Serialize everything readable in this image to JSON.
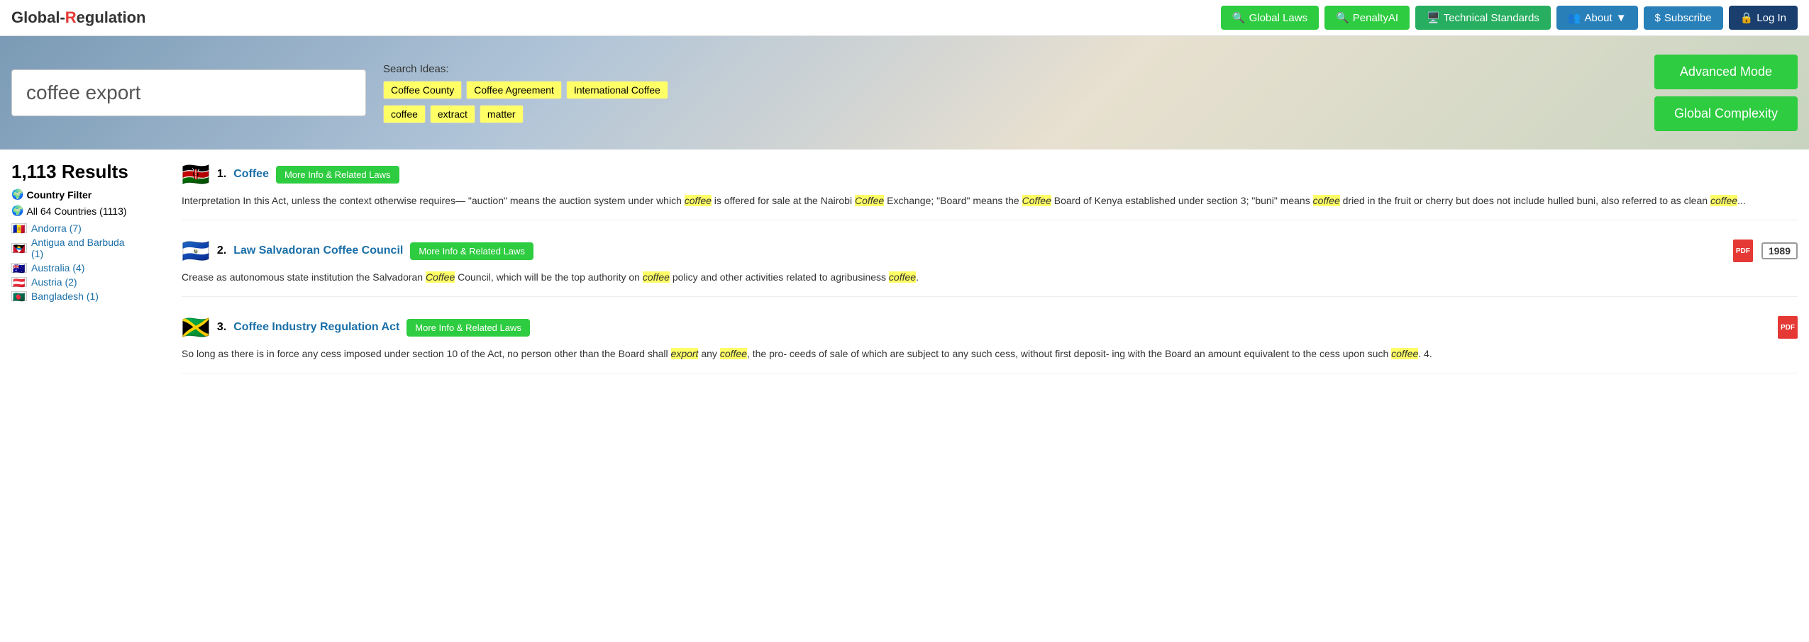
{
  "logo": {
    "text_g": "Global-",
    "text_r": "R",
    "text_rest": "egulation"
  },
  "nav": {
    "global_laws": "Global Laws",
    "penalty_ai": "PenaltyAI",
    "technical_standards": "Technical Standards",
    "about": "About",
    "subscribe": "Subscribe",
    "log_in": "Log In"
  },
  "search": {
    "value": "coffee export",
    "ideas_label": "Search Ideas:",
    "ideas_row1": [
      "Coffee County",
      "Coffee Agreement",
      "International Coffee"
    ],
    "ideas_row2": [
      "coffee",
      "extract",
      "matter"
    ]
  },
  "hero_buttons": {
    "advanced_mode": "Advanced Mode",
    "global_complexity": "Global Complexity"
  },
  "sidebar": {
    "results_count": "1,113 Results",
    "country_filter_label": "Country Filter",
    "all_countries": "All 64 Countries (1113)",
    "countries": [
      {
        "flag": "🇦🇩",
        "name": "Andorra",
        "count": "(7)"
      },
      {
        "flag": "🇦🇬",
        "name": "Antigua and Barbuda",
        "count": "(1)"
      },
      {
        "flag": "🇦🇺",
        "name": "Australia",
        "count": "(4)"
      },
      {
        "flag": "🇦🇹",
        "name": "Austria",
        "count": "(2)"
      },
      {
        "flag": "🇧🇩",
        "name": "Bangladesh",
        "count": "(1)"
      }
    ]
  },
  "results": [
    {
      "num": "1.",
      "title": "Coffee",
      "more_info_btn": "More Info & Related Laws",
      "flag": "kenya",
      "flag_emoji": "🇰🇪",
      "snippet": "Interpretation In this Act, unless the context otherwise requires— \"auction\" means the auction system under which ",
      "highlight1": "coffee",
      "mid1": " is offered for sale at the Nairobi ",
      "highlight2": "Coffee",
      "mid2": " Exchange; \"Board\" means the ",
      "highlight3": "Coffee",
      "mid3": " Board of Kenya established under section 3; \"buni\" means ",
      "highlight4": "coffee",
      "mid4": " dried in the fruit or cherry but does not include hulled buni, also referred to as clean ",
      "highlight5": "coffee",
      "end": "...",
      "has_year": false,
      "has_pdf": false
    },
    {
      "num": "2.",
      "title": "Law Salvadoran Coffee Council",
      "more_info_btn": "More Info & Related Laws",
      "flag": "el-salvador",
      "flag_emoji": "🇸🇻",
      "snippet": "Crease as autonomous state institution the Salvadoran ",
      "highlight1": "Coffee",
      "mid1": " Council, which will be the top authority on ",
      "highlight2": "coffee",
      "mid2": " policy and other activities related to agribusiness ",
      "highlight3": "coffee",
      "end": ".",
      "has_year": true,
      "year": "1989",
      "has_pdf": true
    },
    {
      "num": "3.",
      "title": "Coffee Industry Regulation Act",
      "more_info_btn": "More Info & Related Laws",
      "flag": "jamaica",
      "flag_emoji": "🇯🇲",
      "snippet": "So long as there is in force any cess imposed under section 10 of the Act, no person other than the Board shall ",
      "highlight1": "export",
      "mid1": " any ",
      "highlight2": "coffee",
      "mid2": ", the pro- ceeds of sale of which are subject to any such cess, without first deposit- ing with the Board an amount equivalent to the cess upon such ",
      "highlight3": "coffee",
      "end": ". 4.",
      "has_year": false,
      "has_pdf": true
    }
  ]
}
